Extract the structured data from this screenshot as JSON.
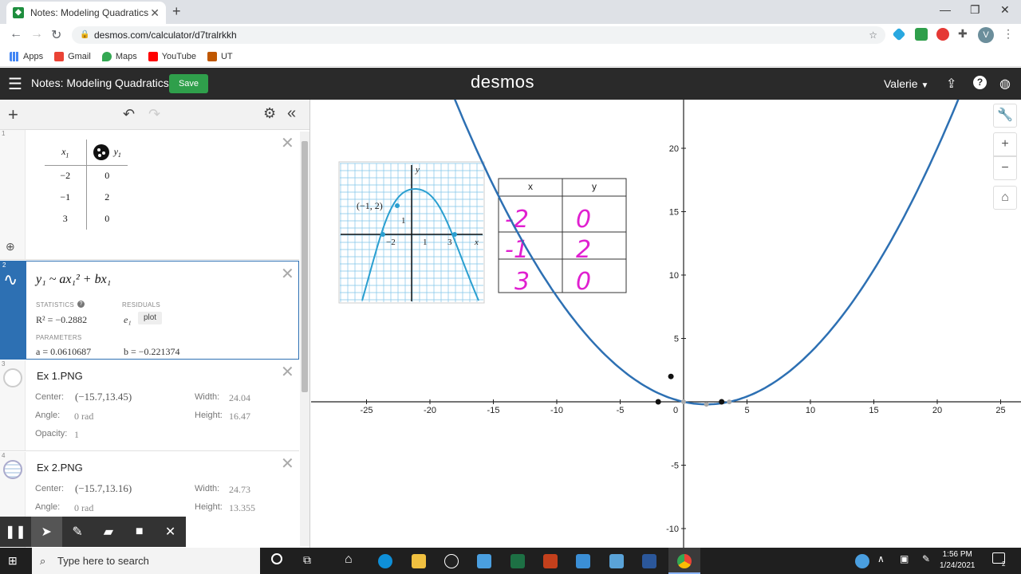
{
  "browser": {
    "tab_title": "Notes: Modeling Quadratics",
    "url": "desmos.com/calculator/d7tralrkkh",
    "bookmarks": [
      "Apps",
      "Gmail",
      "Maps",
      "YouTube",
      "UT"
    ]
  },
  "header": {
    "title": "Notes: Modeling Quadratics",
    "save_label": "Save",
    "logo": "desmos",
    "user": "Valerie"
  },
  "expressions": {
    "table": {
      "number": "1",
      "col1": "x",
      "col1_sub": "1",
      "col2": "y",
      "col2_sub": "1",
      "rows": [
        [
          "−2",
          "0"
        ],
        [
          "−1",
          "2"
        ],
        [
          "3",
          "0"
        ]
      ]
    },
    "regression": {
      "number": "2",
      "formula": "y₁ ~ ax₁² + bx₁",
      "statistics_label": "STATISTICS",
      "residuals_label": "RESIDUALS",
      "r2": "R² = −0.2882",
      "residual_var": "e₁",
      "plot_label": "plot",
      "parameters_label": "PARAMETERS",
      "a": "a = 0.0610687",
      "b": "b = −0.221374"
    },
    "image1": {
      "number": "3",
      "name": "Ex 1.PNG",
      "center_label": "Center:",
      "center": "(−15.7,13.45)",
      "width_label": "Width:",
      "width": "24.04",
      "angle_label": "Angle:",
      "angle": "0 rad",
      "height_label": "Height:",
      "height": "16.47",
      "opacity_label": "Opacity:",
      "opacity": "1"
    },
    "image2": {
      "number": "4",
      "name": "Ex 2.PNG",
      "center_label": "Center:",
      "center": "(−15.7,13.16)",
      "width_label": "Width:",
      "width": "24.73",
      "angle_label": "Angle:",
      "angle": "0 rad",
      "height_label": "Height:",
      "height": "13.355"
    }
  },
  "graph": {
    "x_ticks": [
      "-25",
      "-20",
      "-15",
      "-10",
      "-5",
      "0",
      "5",
      "10",
      "15",
      "20",
      "25"
    ],
    "y_ticks": [
      "20",
      "15",
      "10",
      "5",
      "-5",
      "-10"
    ],
    "inset_table": {
      "headers": [
        "x",
        "y"
      ],
      "rows": [
        [
          "-2",
          "0"
        ],
        [
          "-1",
          "2"
        ],
        [
          "3",
          "0"
        ]
      ]
    },
    "inset_graph": {
      "point_label": "(−1, 2)",
      "axis_x": "x",
      "axis_y": "y",
      "labels": [
        "−2",
        "1",
        "3",
        "1"
      ]
    }
  },
  "taskbar": {
    "search_placeholder": "Type here to search",
    "time": "1:56 PM",
    "date": "1/24/2021",
    "notif_count": "2"
  },
  "colors": {
    "curve": "#2d70b3",
    "save": "#2f9f4b",
    "handwriting": "#e020d0"
  }
}
